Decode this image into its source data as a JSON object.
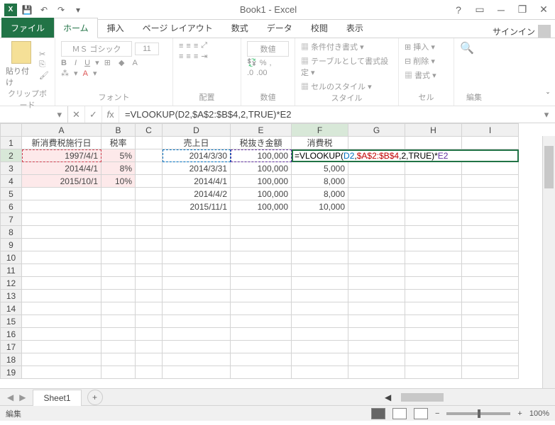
{
  "title": "Book1 - Excel",
  "qat": {
    "save": "💾",
    "undo": "↶",
    "redo": "↷"
  },
  "win": {
    "help": "?",
    "ribbon": "▭",
    "min": "─",
    "restore": "❐",
    "close": "✕"
  },
  "tabs": {
    "file": "ファイル",
    "home": "ホーム",
    "insert": "挿入",
    "layout": "ページ レイアウト",
    "formula": "数式",
    "data": "データ",
    "review": "校閲",
    "view": "表示"
  },
  "signin": "サインイン",
  "ribbon": {
    "clipboard": {
      "paste": "貼り付け",
      "label": "クリップボード"
    },
    "font": {
      "name": "ＭＳ ゴシック",
      "size": "11",
      "label": "フォント"
    },
    "align": {
      "label": "配置"
    },
    "number": {
      "format": "数値",
      "label": "数値"
    },
    "styles": {
      "cond": "条件付き書式",
      "table": "テーブルとして書式設定",
      "cell": "セルのスタイル",
      "label": "スタイル"
    },
    "cells": {
      "insert": "挿入",
      "delete": "削除",
      "format": "書式",
      "label": "セル"
    },
    "editing": {
      "label": "編集"
    }
  },
  "fbar": {
    "name": "",
    "formula": "=VLOOKUP(D2,$A$2:$B$4,2,TRUE)*E2"
  },
  "cols": [
    "A",
    "B",
    "C",
    "D",
    "E",
    "F",
    "G",
    "H",
    "I"
  ],
  "rows": [
    "1",
    "2",
    "3",
    "4",
    "5",
    "6",
    "7",
    "8",
    "9",
    "10",
    "11",
    "12",
    "13",
    "14",
    "15",
    "16",
    "17",
    "18",
    "19"
  ],
  "hdr": {
    "A1": "新消費税施行日",
    "B1": "税率",
    "D1": "売上日",
    "E1": "税抜き金額",
    "F1": "消費税"
  },
  "data": {
    "A2": "1997/4/1",
    "B2": "5%",
    "D2": "2014/3/30",
    "E2": "100,000",
    "A3": "2014/4/1",
    "B3": "8%",
    "D3": "2014/3/31",
    "E3": "100,000",
    "F3": "5,000",
    "A4": "2015/10/1",
    "B4": "10%",
    "D4": "2014/4/1",
    "E4": "100,000",
    "F4": "8,000",
    "D5": "2014/4/2",
    "E5": "100,000",
    "F5": "8,000",
    "D6": "2015/11/1",
    "E6": "100,000",
    "F6": "10,000"
  },
  "f2": {
    "p1": "=VLOOKUP(",
    "d2": "D2",
    "p2": ",",
    "r1": "$A$2:$B$4",
    "p3": ",2,TRUE)*",
    "e2": "E2"
  },
  "sheet": {
    "name": "Sheet1",
    "add": "+"
  },
  "status": {
    "mode": "編集",
    "zoom": "100%"
  }
}
